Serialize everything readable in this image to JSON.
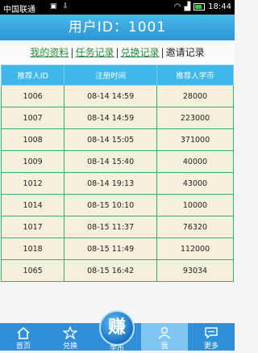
{
  "status": {
    "carrier": "中国联通",
    "time": "18:44"
  },
  "header": {
    "title": "用户ID：1001"
  },
  "tabs": [
    {
      "label": "我的资料"
    },
    {
      "label": "任务记录"
    },
    {
      "label": "兑换记录"
    },
    {
      "label": "邀请记录"
    }
  ],
  "table": {
    "headers": [
      "推荐人ID",
      "注册时间",
      "推荐人学币"
    ],
    "rows": [
      [
        "1006",
        "08-14 14:59",
        "28000"
      ],
      [
        "1007",
        "08-14 14:59",
        "223000"
      ],
      [
        "1008",
        "08-14 15:05",
        "371000"
      ],
      [
        "1009",
        "08-14 15:40",
        "40000"
      ],
      [
        "1012",
        "08-14 19:13",
        "43000"
      ],
      [
        "1014",
        "08-15 10:10",
        "10000"
      ],
      [
        "1017",
        "08-15 11:37",
        "76320"
      ],
      [
        "1018",
        "08-15 11:49",
        "112000"
      ],
      [
        "1065",
        "08-15 16:42",
        "93034"
      ]
    ]
  },
  "nav": {
    "home": "首页",
    "exchange": "兑换",
    "earn_glyph": "赚",
    "earn": "学币",
    "me": "我",
    "more": "更多"
  },
  "colors": {
    "accent": "#2f8fd8",
    "header": "#3fb7ea",
    "row_bg": "#f6efdc",
    "row_border": "#2fb36f",
    "tab_link": "#2c8a3c"
  }
}
